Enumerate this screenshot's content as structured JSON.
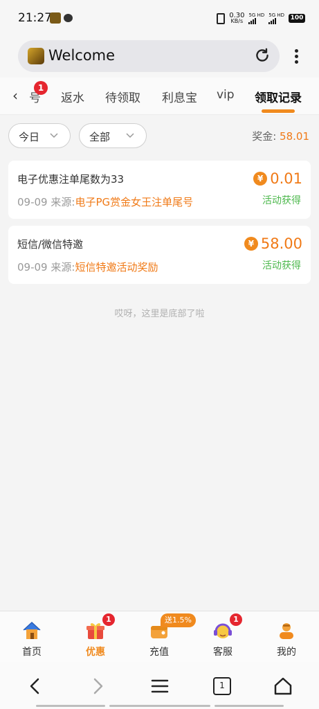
{
  "status_bar": {
    "time": "21:27",
    "net_speed_value": "0.30",
    "net_speed_unit": "KB/s",
    "signal1_label": "5G HD",
    "signal2_label": "5G HD",
    "battery": "100"
  },
  "browser": {
    "title": "Welcome"
  },
  "tabs": {
    "partial_label": "号",
    "partial_badge": "1",
    "items": [
      {
        "label": "返水"
      },
      {
        "label": "待领取"
      },
      {
        "label": "利息宝"
      },
      {
        "label": "vip"
      },
      {
        "label": "领取记录"
      }
    ],
    "active_index": 4
  },
  "filters": {
    "date": "今日",
    "type": "全部"
  },
  "summary": {
    "label": "奖金:",
    "amount": "58.01"
  },
  "records": [
    {
      "title": "电子优惠注单尾数为33",
      "date": "09-09",
      "source_label": "来源:",
      "source": "电子PG赏金女王注单尾号",
      "amount": "0.01",
      "status": "活动获得"
    },
    {
      "title": "短信/微信特邀",
      "date": "09-09",
      "source_label": "来源:",
      "source": "短信特邀活动奖励",
      "amount": "58.00",
      "status": "活动获得"
    }
  ],
  "end_tip": "哎呀，这里是底部了啦",
  "currency_symbol": "¥",
  "bottom_nav": {
    "items": [
      {
        "label": "首页",
        "icon": "home-icon"
      },
      {
        "label": "优惠",
        "icon": "gift-icon",
        "badge": "1"
      },
      {
        "label": "充值",
        "icon": "wallet-icon",
        "tag": "送1.5%"
      },
      {
        "label": "客服",
        "icon": "support-icon",
        "badge": "1"
      },
      {
        "label": "我的",
        "icon": "profile-icon"
      }
    ],
    "active_index": 1
  },
  "system_nav": {
    "tab_count": "1"
  },
  "colors": {
    "accent": "#f08a1e",
    "success": "#4cb84c",
    "badge": "#e5262f"
  }
}
